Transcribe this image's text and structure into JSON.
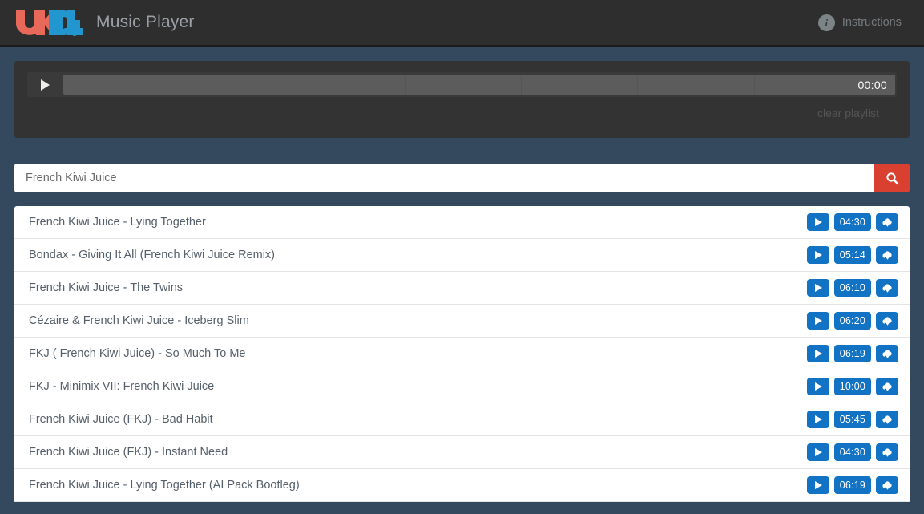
{
  "header": {
    "logo": {
      "icon_name": "ukdl-logo",
      "text_left": "UK",
      "text_right": "DL",
      "color_left": "#e8695a",
      "color_right": "#2196cf"
    },
    "title": "Music Player",
    "instructions": {
      "icon_name": "info-icon",
      "glyph": "i",
      "label": "Instructions"
    }
  },
  "player": {
    "play_icon_name": "play-icon",
    "time": "00:00",
    "progress_percent": 0,
    "clear_playlist_label": "clear playlist"
  },
  "search": {
    "value": "French Kiwi Juice",
    "placeholder": "French Kiwi Juice",
    "button_icon_name": "search-icon",
    "button_color": "#d9402f"
  },
  "results": {
    "accent_color": "#1272c4",
    "items": [
      {
        "title": "French Kiwi Juice - Lying Together",
        "duration": "04:30"
      },
      {
        "title": "Bondax - Giving It All (French Kiwi Juice Remix)",
        "duration": "05:14"
      },
      {
        "title": "French Kiwi Juice - The Twins",
        "duration": "06:10"
      },
      {
        "title": "Cézaire & French Kiwi Juice - Iceberg Slim",
        "duration": "06:20"
      },
      {
        "title": "FKJ ( French Kiwi Juice) - So Much To Me",
        "duration": "06:19"
      },
      {
        "title": "FKJ - Minimix VII: French Kiwi Juice",
        "duration": "10:00"
      },
      {
        "title": "French Kiwi Juice (FKJ) - Bad Habit",
        "duration": "05:45"
      },
      {
        "title": "French Kiwi Juice (FKJ) - Instant Need",
        "duration": "04:30"
      },
      {
        "title": "French Kiwi Juice - Lying Together (AI Pack Bootleg)",
        "duration": "06:19"
      }
    ]
  }
}
